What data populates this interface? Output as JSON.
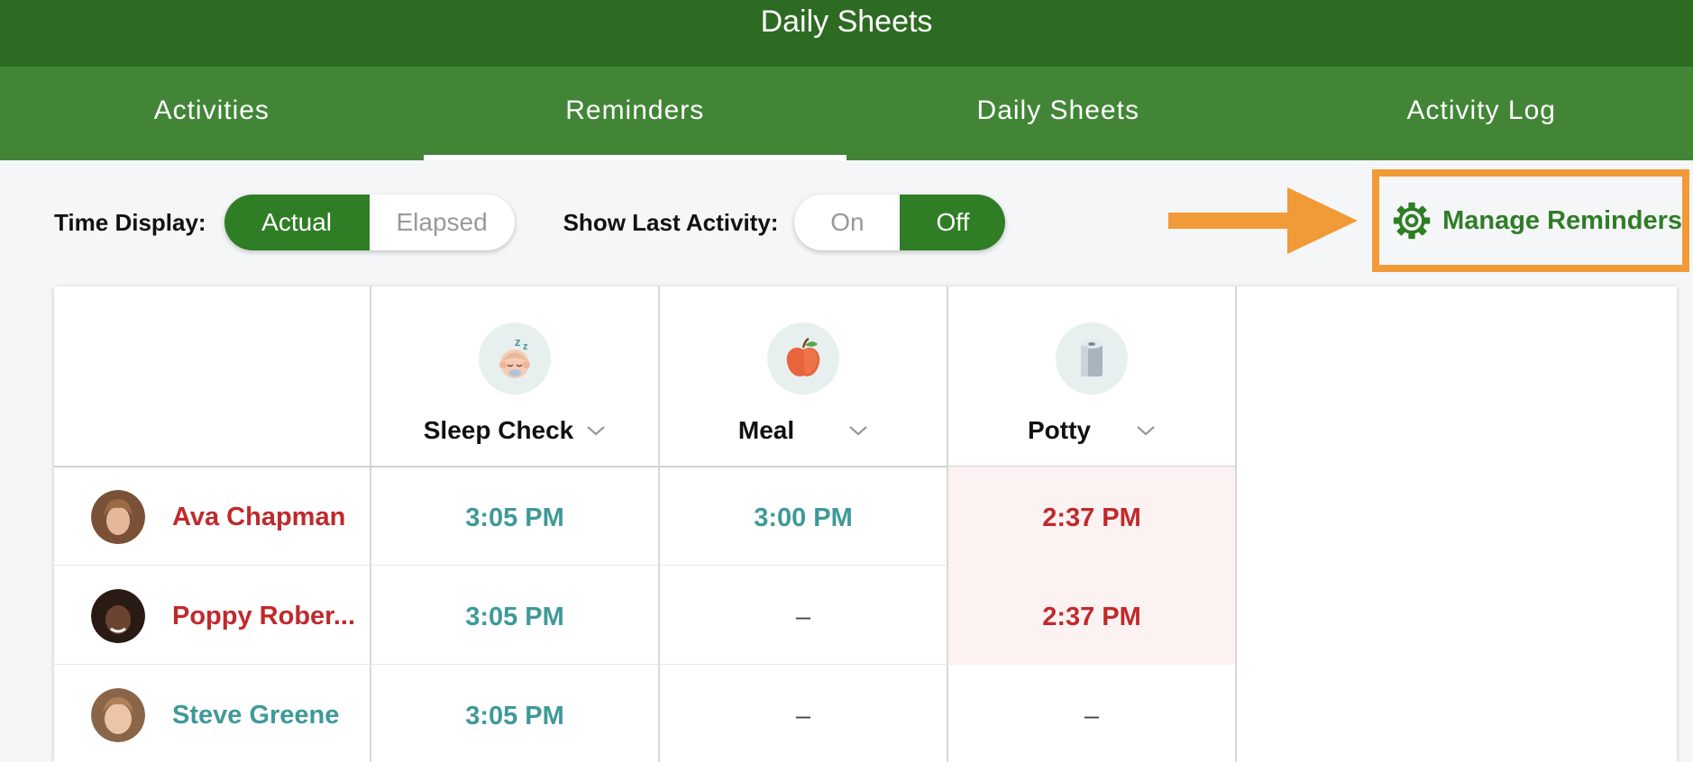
{
  "header": {
    "title": "Daily Sheets"
  },
  "tabs": [
    {
      "label": "Activities"
    },
    {
      "label": "Reminders"
    },
    {
      "label": "Daily Sheets"
    },
    {
      "label": "Activity Log"
    }
  ],
  "controls": {
    "time_display_label": "Time Display:",
    "time_display_options": [
      "Actual",
      "Elapsed"
    ],
    "time_display_selected": "Actual",
    "show_last_label": "Show Last Activity:",
    "show_last_options": [
      "On",
      "Off"
    ],
    "show_last_selected": "Off",
    "manage_label": "Manage Reminders"
  },
  "columns": [
    {
      "name": "Sleep Check",
      "icon": "sleeping-baby-icon"
    },
    {
      "name": "Meal",
      "icon": "apple-icon"
    },
    {
      "name": "Potty",
      "icon": "toilet-paper-icon"
    }
  ],
  "children": [
    {
      "name": "Ava Chapman",
      "status": "overdue",
      "cells": [
        "3:05 PM",
        "3:00 PM",
        "2:37 PM"
      ]
    },
    {
      "name": "Poppy Rober...",
      "status": "overdue",
      "cells": [
        "3:05 PM",
        "–",
        "2:37 PM"
      ]
    },
    {
      "name": "Steve Greene",
      "status": "ok",
      "cells": [
        "3:05 PM",
        "–",
        "–"
      ]
    }
  ],
  "colors": {
    "header_dark": "#2d6a22",
    "tab_bar": "#428537",
    "accent_green": "#2f7d25",
    "highlight_orange": "#f19a38",
    "overdue_red": "#c0292c",
    "ok_teal": "#3e9a98"
  }
}
